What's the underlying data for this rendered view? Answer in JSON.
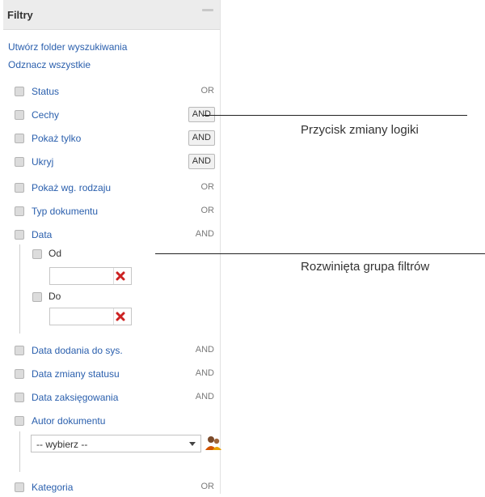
{
  "panel": {
    "title": "Filtry",
    "links": {
      "create_folder": "Utwórz folder wyszukiwania",
      "uncheck_all": "Odznacz wszystkie"
    }
  },
  "filters": [
    {
      "label": "Status",
      "logic": "OR"
    },
    {
      "label": "Cechy",
      "logic": "AND"
    },
    {
      "label": "Pokaż tylko",
      "logic": "AND"
    },
    {
      "label": "Ukryj",
      "logic": "AND"
    },
    {
      "label": "Pokaż wg. rodzaju",
      "logic": "OR"
    },
    {
      "label": "Typ dokumentu",
      "logic": "OR"
    },
    {
      "label": "Data",
      "logic": "AND"
    },
    {
      "label": "Data dodania do sys.",
      "logic": "AND"
    },
    {
      "label": "Data zmiany statusu",
      "logic": "AND"
    },
    {
      "label": "Data zaksięgowania",
      "logic": "AND"
    },
    {
      "label": "Autor dokumentu",
      "logic": ""
    },
    {
      "label": "Kategoria",
      "logic": "OR"
    }
  ],
  "date_group": {
    "from_label": "Od",
    "to_label": "Do",
    "from_value": "",
    "to_value": ""
  },
  "author_select": {
    "selected": "-- wybierz --"
  },
  "annotations": {
    "logic_button": "Przycisk zmiany logiki",
    "expanded_group": "Rozwinięta grupa filtrów"
  },
  "colors": {
    "link": "#2a5fad",
    "header_bg": "#ececec",
    "clear_icon": "#cc2222"
  }
}
